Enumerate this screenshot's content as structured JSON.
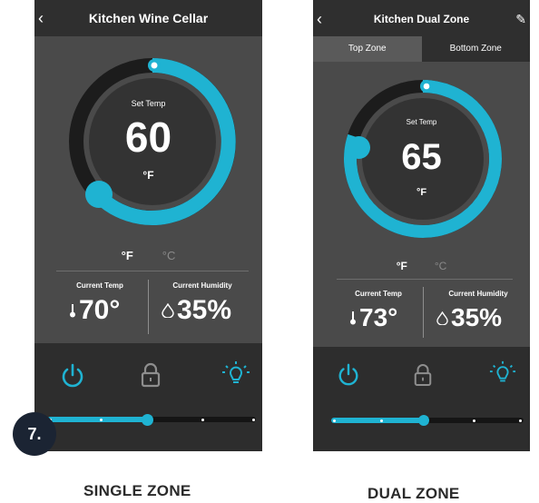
{
  "single": {
    "title": "Kitchen Wine Cellar",
    "set_temp_label": "Set Temp",
    "set_temp_value": "60",
    "set_temp_unit": "°F",
    "unit_f": "°F",
    "unit_c": "°C",
    "current_temp_label": "Current Temp",
    "current_temp_value": "70°",
    "current_humidity_label": "Current Humidity",
    "current_humidity_value": "35%"
  },
  "dual": {
    "title": "Kitchen Dual Zone",
    "tabs": [
      "Top Zone",
      "Bottom Zone"
    ],
    "set_temp_label": "Set Temp",
    "set_temp_value": "65",
    "set_temp_unit": "°F",
    "unit_f": "°F",
    "unit_c": "°C",
    "current_temp_label": "Current Temp",
    "current_temp_value": "73°",
    "current_humidity_label": "Current Humidity",
    "current_humidity_value": "35%"
  },
  "badge": "7.",
  "captions": {
    "single": "SINGLE ZONE",
    "dual": "DUAL ZONE"
  },
  "colors": {
    "accent": "#1fb3d2",
    "dark": "#2f2f2f",
    "panel": "#4a4a4a"
  },
  "sliders": {
    "single_level": 0.48,
    "dual_level": 0.48
  }
}
